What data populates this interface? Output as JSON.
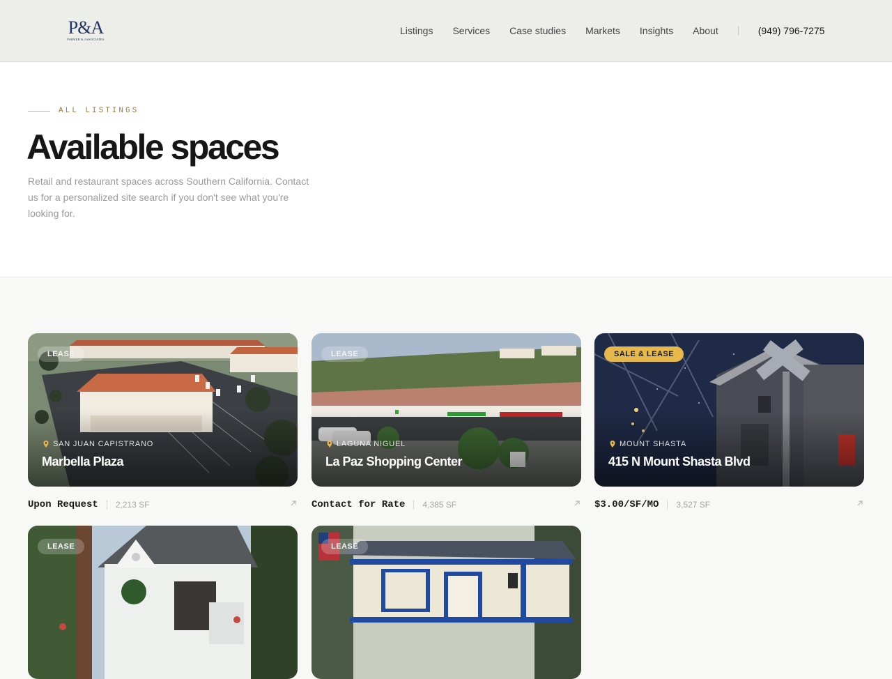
{
  "brand": {
    "logo_mark": "P&A",
    "logo_sub": "PARKER & ASSOCIATES"
  },
  "nav": {
    "items": [
      "Listings",
      "Services",
      "Case studies",
      "Markets",
      "Insights",
      "About"
    ],
    "phone": "(949) 796-7275"
  },
  "hero": {
    "eyebrow": "ALL LISTINGS",
    "title": "Available spaces",
    "lede": "Retail and restaurant spaces across Southern California. Contact us for a personalized site search if you don't see what you're looking for."
  },
  "listings": [
    {
      "badge": "LEASE",
      "location": "SAN JUAN CAPISTRANO",
      "name": "Marbella Plaza",
      "price": "Upon Request",
      "size": "2,213 SF"
    },
    {
      "badge": "LEASE",
      "location": "LAGUNA NIGUEL",
      "name": "La Paz Shopping Center",
      "price": "Contact for Rate",
      "size": "4,385 SF"
    },
    {
      "badge": "SALE & LEASE",
      "location": "MOUNT SHASTA",
      "name": "415 N Mount Shasta Blvd",
      "price": "$3.00/SF/MO",
      "size": "3,527 SF"
    },
    {
      "badge": "LEASE"
    },
    {
      "badge": "LEASE"
    }
  ],
  "colors": {
    "accent_gold": "#e6b94a",
    "brand_navy": "#1e3464",
    "eyebrow_text": "#9a7c3f"
  },
  "icons": [
    "location-pin-icon",
    "arrow-up-right-icon"
  ]
}
